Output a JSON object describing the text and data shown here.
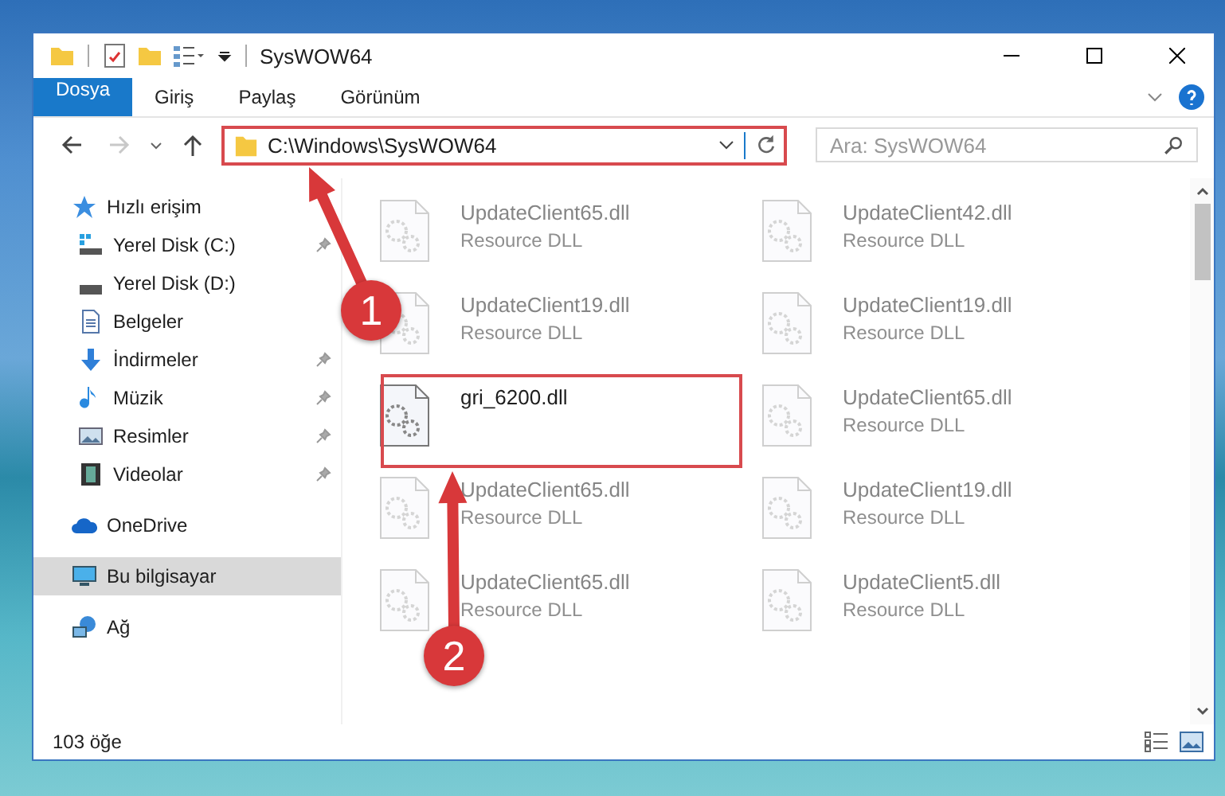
{
  "window": {
    "title": "SysWOW64"
  },
  "ribbon_tabs": [
    {
      "label": "Dosya",
      "kind": "file"
    },
    {
      "label": "Giriş",
      "kind": "tab"
    },
    {
      "label": "Paylaş",
      "kind": "tab"
    },
    {
      "label": "Görünüm",
      "kind": "tab"
    }
  ],
  "navigation": {
    "forward_disabled": true
  },
  "address_bar": {
    "path": "C:\\Windows\\SysWOW64"
  },
  "search": {
    "placeholder": "Ara: SysWOW64"
  },
  "sidebar": {
    "items": [
      {
        "label": "Hızlı erişim",
        "kind": "star",
        "selected": false,
        "children": [
          {
            "label": "Yerel Disk (C:)",
            "kind": "windrive",
            "pinned": true,
            "selected": false
          },
          {
            "label": "Yerel Disk (D:)",
            "kind": "drive",
            "pinned": false,
            "selected": false
          },
          {
            "label": "Belgeler",
            "kind": "documents",
            "pinned": false,
            "selected": false
          },
          {
            "label": "İndirmeler",
            "kind": "download",
            "pinned": true,
            "selected": false
          },
          {
            "label": "Müzik",
            "kind": "music",
            "pinned": true,
            "selected": false
          },
          {
            "label": "Resimler",
            "kind": "pictures",
            "pinned": true,
            "selected": false
          },
          {
            "label": "Videolar",
            "kind": "videos",
            "pinned": true,
            "selected": false
          }
        ]
      },
      {
        "label": "OneDrive",
        "kind": "cloud",
        "selected": false
      },
      {
        "label": "Bu bilgisayar",
        "kind": "computer",
        "selected": true
      },
      {
        "label": "Ağ",
        "kind": "network",
        "selected": false
      }
    ]
  },
  "files": [
    {
      "name": "UpdateClient65.dll",
      "type": "Resource DLL",
      "dimmed": true
    },
    {
      "name": "UpdateClient42.dll",
      "type": "Resource DLL",
      "dimmed": true
    },
    {
      "name": "UpdateClient19.dll",
      "type": "Resource DLL",
      "dimmed": true
    },
    {
      "name": "UpdateClient19.dll",
      "type": "Resource DLL",
      "dimmed": true
    },
    {
      "name": "gri_6200.dll",
      "dimmed": false
    },
    {
      "name": "UpdateClient65.dll",
      "type": "Resource DLL",
      "dimmed": true
    },
    {
      "name": "UpdateClient65.dll",
      "type": "Resource DLL",
      "dimmed": true
    },
    {
      "name": "UpdateClient19.dll",
      "type": "Resource DLL",
      "dimmed": true
    },
    {
      "name": "UpdateClient65.dll",
      "type": "Resource DLL",
      "dimmed": true
    },
    {
      "name": "UpdateClient5.dll",
      "type": "Resource DLL",
      "dimmed": true
    }
  ],
  "status_bar": {
    "item_count": "103 öğe"
  },
  "annotations": [
    {
      "label": "1"
    },
    {
      "label": "2"
    }
  ]
}
